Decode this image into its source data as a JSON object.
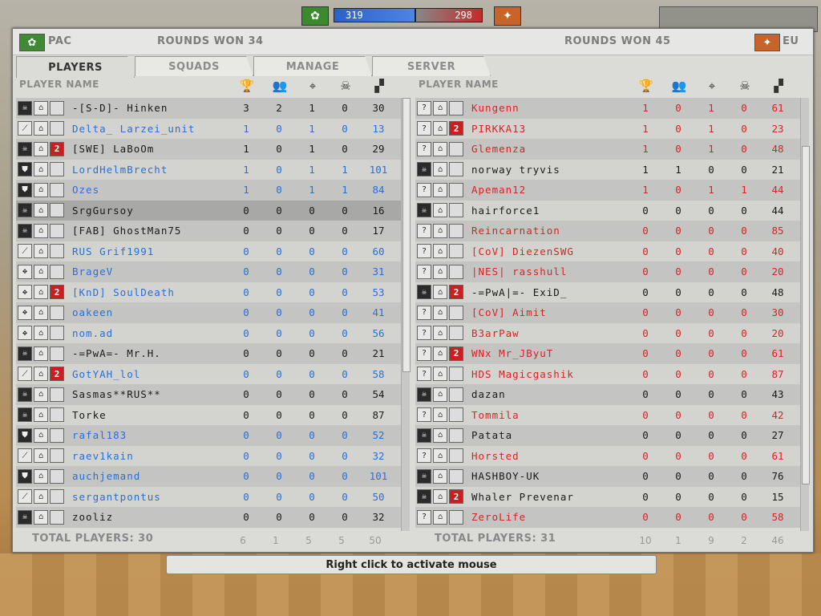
{
  "hud": {
    "left_tickets": "319",
    "right_tickets": "298"
  },
  "left_team": {
    "name": "PAC",
    "rounds_won": "ROUNDS WON 34",
    "total_players": "TOTAL PLAYERS: 30",
    "totals": [
      "6",
      "1",
      "5",
      "5",
      "50"
    ]
  },
  "right_team": {
    "name": "EU",
    "rounds_won": "ROUNDS WON 45",
    "total_players": "TOTAL PLAYERS: 31",
    "totals": [
      "10",
      "1",
      "9",
      "2",
      "46"
    ]
  },
  "tabs": [
    "PLAYERS",
    "SQUADS",
    "MANAGE",
    "SERVER"
  ],
  "column_header": "PLAYER NAME",
  "hint": "Right click to activate mouse",
  "colors": {
    "blue": "#2a6fd6",
    "red": "#d82424",
    "black": "#1a1a1a"
  },
  "left_rows": [
    {
      "name": "-[S-D]- Hinken",
      "s": [
        "3",
        "2",
        "1",
        "0",
        "30"
      ],
      "c": "black",
      "i": [
        "skull",
        "rank",
        ""
      ]
    },
    {
      "name": "Delta_ Larzei_unit",
      "s": [
        "1",
        "0",
        "1",
        "0",
        "13"
      ],
      "c": "blue",
      "i": [
        "knife",
        "rank",
        ""
      ]
    },
    {
      "name": "[SWE] LaBoOm",
      "s": [
        "1",
        "0",
        "1",
        "0",
        "29"
      ],
      "c": "black",
      "i": [
        "skull",
        "rank",
        "2"
      ]
    },
    {
      "name": "LordHelmBrecht",
      "s": [
        "1",
        "0",
        "1",
        "1",
        "101"
      ],
      "c": "blue",
      "i": [
        "shield",
        "rank",
        ""
      ]
    },
    {
      "name": "Ozes",
      "s": [
        "1",
        "0",
        "1",
        "1",
        "84"
      ],
      "c": "blue",
      "i": [
        "shield",
        "rank",
        ""
      ]
    },
    {
      "name": "SrgGursoy",
      "s": [
        "0",
        "0",
        "0",
        "0",
        "16"
      ],
      "c": "black",
      "i": [
        "skull",
        "rank",
        ""
      ],
      "sel": true
    },
    {
      "name": "[FAB] GhostMan75",
      "s": [
        "0",
        "0",
        "0",
        "0",
        "17"
      ],
      "c": "black",
      "i": [
        "skull",
        "rank",
        ""
      ]
    },
    {
      "name": "RUS Grif1991",
      "s": [
        "0",
        "0",
        "0",
        "0",
        "60"
      ],
      "c": "blue",
      "i": [
        "knife",
        "rank",
        ""
      ]
    },
    {
      "name": "BrageV",
      "s": [
        "0",
        "0",
        "0",
        "0",
        "31"
      ],
      "c": "blue",
      "i": [
        "cross",
        "rank",
        ""
      ]
    },
    {
      "name": "[KnD] SoulDeath",
      "s": [
        "0",
        "0",
        "0",
        "0",
        "53"
      ],
      "c": "blue",
      "i": [
        "cross",
        "rank",
        "2"
      ]
    },
    {
      "name": "oakeen",
      "s": [
        "0",
        "0",
        "0",
        "0",
        "41"
      ],
      "c": "blue",
      "i": [
        "cross",
        "rank",
        ""
      ]
    },
    {
      "name": "nom.ad",
      "s": [
        "0",
        "0",
        "0",
        "0",
        "56"
      ],
      "c": "blue",
      "i": [
        "cross",
        "rank",
        ""
      ]
    },
    {
      "name": "-=PwA=- Mr.H.",
      "s": [
        "0",
        "0",
        "0",
        "0",
        "21"
      ],
      "c": "black",
      "i": [
        "skull",
        "rank",
        ""
      ]
    },
    {
      "name": "GotYAH_lol",
      "s": [
        "0",
        "0",
        "0",
        "0",
        "58"
      ],
      "c": "blue",
      "i": [
        "knife",
        "rank",
        "2"
      ]
    },
    {
      "name": "Sasmas**RUS**",
      "s": [
        "0",
        "0",
        "0",
        "0",
        "54"
      ],
      "c": "black",
      "i": [
        "skull",
        "rank",
        ""
      ]
    },
    {
      "name": "Torke",
      "s": [
        "0",
        "0",
        "0",
        "0",
        "87"
      ],
      "c": "black",
      "i": [
        "skull",
        "rank",
        ""
      ]
    },
    {
      "name": "rafal183",
      "s": [
        "0",
        "0",
        "0",
        "0",
        "52"
      ],
      "c": "blue",
      "i": [
        "shield",
        "rank",
        ""
      ]
    },
    {
      "name": "raev1kain",
      "s": [
        "0",
        "0",
        "0",
        "0",
        "32"
      ],
      "c": "blue",
      "i": [
        "knife",
        "rank",
        ""
      ]
    },
    {
      "name": "auchjemand",
      "s": [
        "0",
        "0",
        "0",
        "0",
        "101"
      ],
      "c": "blue",
      "i": [
        "shield",
        "rank",
        ""
      ]
    },
    {
      "name": "sergantpontus",
      "s": [
        "0",
        "0",
        "0",
        "0",
        "50"
      ],
      "c": "blue",
      "i": [
        "knife",
        "rank",
        ""
      ]
    },
    {
      "name": "zooliz",
      "s": [
        "0",
        "0",
        "0",
        "0",
        "32"
      ],
      "c": "black",
      "i": [
        "skull",
        "rank",
        ""
      ]
    }
  ],
  "right_rows": [
    {
      "name": "Kungenn",
      "s": [
        "1",
        "0",
        "1",
        "0",
        "61"
      ],
      "c": "red",
      "i": [
        "?",
        "rank",
        ""
      ]
    },
    {
      "name": "PIRKKA13",
      "s": [
        "1",
        "0",
        "1",
        "0",
        "23"
      ],
      "c": "red",
      "i": [
        "?",
        "rank",
        "2"
      ]
    },
    {
      "name": "Glemenza",
      "s": [
        "1",
        "0",
        "1",
        "0",
        "48"
      ],
      "c": "red",
      "i": [
        "?",
        "rank",
        ""
      ]
    },
    {
      "name": "norway tryvis",
      "s": [
        "1",
        "1",
        "0",
        "0",
        "21"
      ],
      "c": "black",
      "i": [
        "skull",
        "rank",
        ""
      ]
    },
    {
      "name": "Apeman12",
      "s": [
        "1",
        "0",
        "1",
        "1",
        "44"
      ],
      "c": "red",
      "i": [
        "?",
        "rank",
        ""
      ]
    },
    {
      "name": "hairforce1",
      "s": [
        "0",
        "0",
        "0",
        "0",
        "44"
      ],
      "c": "black",
      "i": [
        "skull",
        "rank",
        ""
      ]
    },
    {
      "name": "Reincarnation",
      "s": [
        "0",
        "0",
        "0",
        "0",
        "85"
      ],
      "c": "red",
      "i": [
        "?",
        "rank",
        ""
      ]
    },
    {
      "name": "[CoV] DiezenSWG",
      "s": [
        "0",
        "0",
        "0",
        "0",
        "40"
      ],
      "c": "red",
      "i": [
        "?",
        "rank",
        ""
      ]
    },
    {
      "name": "|NES| rasshull",
      "s": [
        "0",
        "0",
        "0",
        "0",
        "20"
      ],
      "c": "red",
      "i": [
        "?",
        "rank",
        ""
      ]
    },
    {
      "name": "-=PwA|=- ExiD_",
      "s": [
        "0",
        "0",
        "0",
        "0",
        "48"
      ],
      "c": "black",
      "i": [
        "skull",
        "rank",
        "2"
      ]
    },
    {
      "name": "[CoV] Aimit",
      "s": [
        "0",
        "0",
        "0",
        "0",
        "30"
      ],
      "c": "red",
      "i": [
        "?",
        "rank",
        ""
      ]
    },
    {
      "name": "B3arPaw",
      "s": [
        "0",
        "0",
        "0",
        "0",
        "20"
      ],
      "c": "red",
      "i": [
        "?",
        "rank",
        ""
      ]
    },
    {
      "name": "WNx Mr_JByuT",
      "s": [
        "0",
        "0",
        "0",
        "0",
        "61"
      ],
      "c": "red",
      "i": [
        "?",
        "rank",
        "2"
      ]
    },
    {
      "name": "HDS Magicgashik",
      "s": [
        "0",
        "0",
        "0",
        "0",
        "87"
      ],
      "c": "red",
      "i": [
        "?",
        "rank",
        ""
      ]
    },
    {
      "name": "dazan",
      "s": [
        "0",
        "0",
        "0",
        "0",
        "43"
      ],
      "c": "black",
      "i": [
        "skull",
        "rank",
        ""
      ]
    },
    {
      "name": "Tommila",
      "s": [
        "0",
        "0",
        "0",
        "0",
        "42"
      ],
      "c": "red",
      "i": [
        "?",
        "rank",
        ""
      ]
    },
    {
      "name": "Patata",
      "s": [
        "0",
        "0",
        "0",
        "0",
        "27"
      ],
      "c": "black",
      "i": [
        "skull",
        "rank",
        ""
      ]
    },
    {
      "name": "Horsted",
      "s": [
        "0",
        "0",
        "0",
        "0",
        "61"
      ],
      "c": "red",
      "i": [
        "?",
        "rank",
        ""
      ]
    },
    {
      "name": "HASHBOY-UK",
      "s": [
        "0",
        "0",
        "0",
        "0",
        "76"
      ],
      "c": "black",
      "i": [
        "skull",
        "rank",
        ""
      ]
    },
    {
      "name": "Whaler Prevenar",
      "s": [
        "0",
        "0",
        "0",
        "0",
        "15"
      ],
      "c": "black",
      "i": [
        "skull",
        "rank",
        "2"
      ]
    },
    {
      "name": "ZeroLife",
      "s": [
        "0",
        "0",
        "0",
        "0",
        "58"
      ],
      "c": "red",
      "i": [
        "?",
        "rank",
        ""
      ]
    }
  ]
}
